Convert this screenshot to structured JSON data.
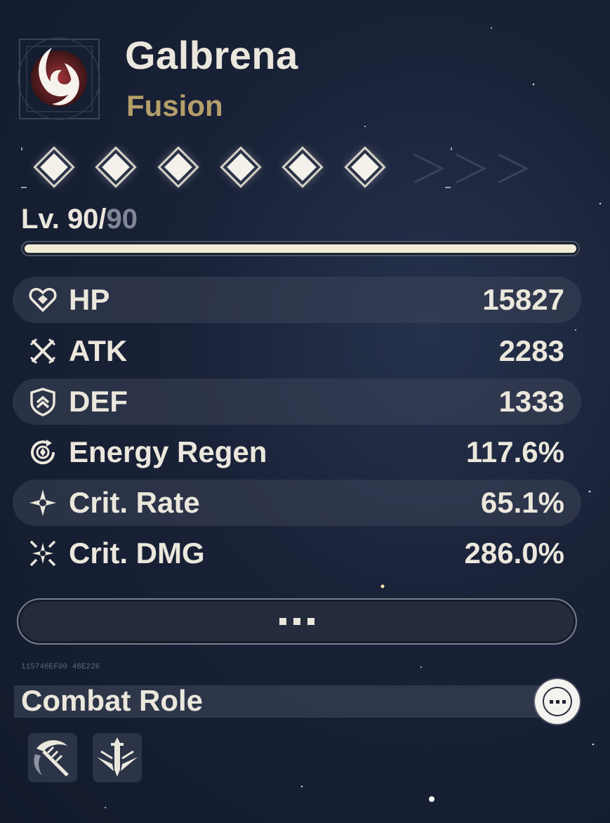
{
  "character": {
    "name": "Galbrena",
    "element": "Fusion",
    "element_icon": "fusion-flame-icon",
    "element_color": "#b59f6a"
  },
  "resonance_chain": {
    "unlocked": 6,
    "total": 6
  },
  "level": {
    "prefix": "Lv. ",
    "current": "90/",
    "max": "90",
    "progress": 1.0
  },
  "stats": [
    {
      "icon": "hp-heart-icon",
      "label": "HP",
      "value": "15827"
    },
    {
      "icon": "atk-crossed-swords-icon",
      "label": "ATK",
      "value": "2283"
    },
    {
      "icon": "def-shield-icon",
      "label": "DEF",
      "value": "1333"
    },
    {
      "icon": "energy-regen-icon",
      "label": "Energy Regen",
      "value": "117.6%"
    },
    {
      "icon": "crit-rate-star-icon",
      "label": "Crit. Rate",
      "value": "65.1%"
    },
    {
      "icon": "crit-dmg-burst-icon",
      "label": "Crit. DMG",
      "value": "286.0%"
    }
  ],
  "more_button": {
    "icon": "ellipsis-icon"
  },
  "combat_role": {
    "tag": "115746EF00 48E226",
    "title": "Combat Role",
    "more_icon": "ellipsis-circle-icon",
    "roles": [
      {
        "icon": "scythe-blade-icon"
      },
      {
        "icon": "sword-wings-icon"
      }
    ]
  },
  "colors": {
    "text": "#ebe7dc",
    "accent": "#b59f6a",
    "bar_fill": "#f1ecd6"
  }
}
